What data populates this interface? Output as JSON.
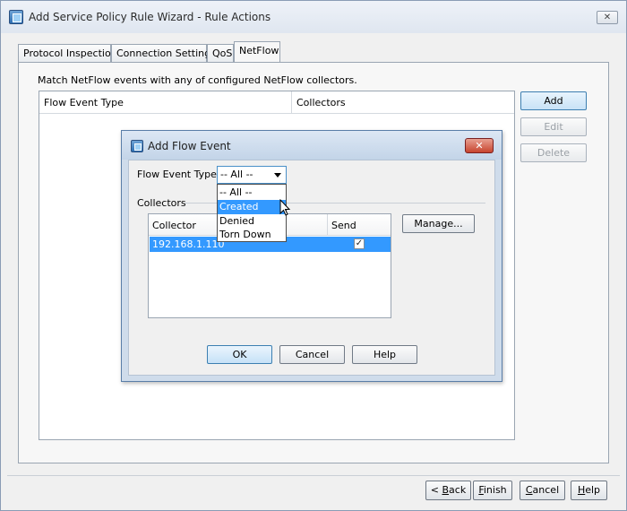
{
  "window": {
    "title": "Add Service Policy Rule Wizard - Rule Actions",
    "close_label": "✕"
  },
  "tabs": [
    {
      "label": "Protocol Inspection"
    },
    {
      "label": "Connection Settings"
    },
    {
      "label": "QoS"
    },
    {
      "label": "NetFlow"
    }
  ],
  "netflow": {
    "match_text": "Match NetFlow events with any of configured NetFlow collectors.",
    "columns": [
      "Flow Event Type",
      "Collectors"
    ],
    "side_buttons": {
      "add": "Add",
      "edit": "Edit",
      "delete": "Delete"
    }
  },
  "footer": {
    "back_underline": "B",
    "back_rest": "ack",
    "finish_underline": "F",
    "finish_rest": "inish",
    "cancel_underline": "C",
    "cancel_rest": "ancel",
    "help_underline": "H",
    "help_rest": "elp"
  },
  "dialog": {
    "title": "Add Flow Event",
    "close_label": "✕",
    "flow_event_label": "Flow Event Type:",
    "selected_value": "-- All --",
    "options": [
      "-- All --",
      "Created",
      "Denied",
      "Torn Down"
    ],
    "highlighted_option": "Created",
    "collectors_label": "Collectors",
    "collector_columns": [
      "Collector",
      "Send"
    ],
    "collector_rows": [
      {
        "collector": "192.168.1.110",
        "send": true
      }
    ],
    "check_mark": "✓",
    "manage_button": "Manage...",
    "ok_button": "OK",
    "cancel_button": "Cancel",
    "help_button": "Help"
  }
}
